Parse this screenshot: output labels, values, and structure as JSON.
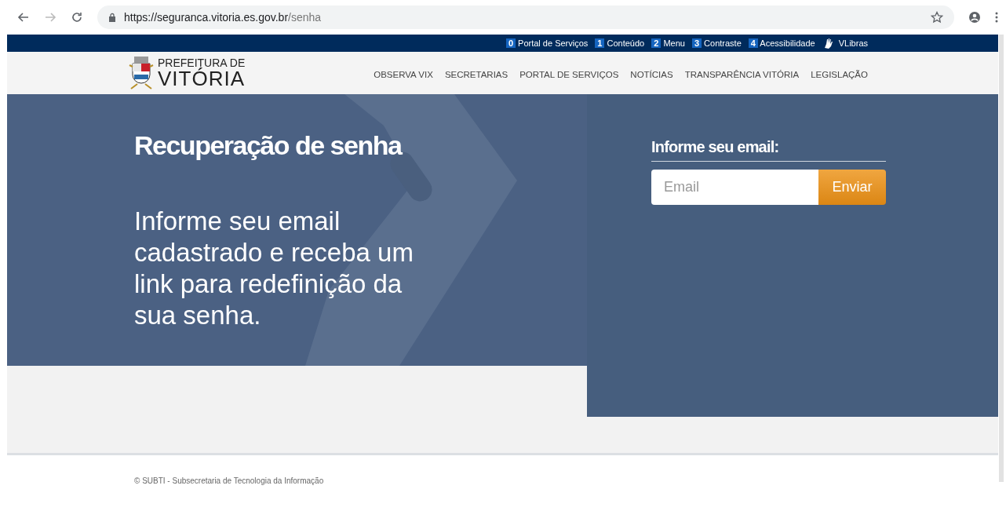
{
  "browser": {
    "url_host": "https://seguranca.vitoria.es.gov.br",
    "url_path": "/senha"
  },
  "access_bar": [
    {
      "key": "0",
      "label": "Portal de Serviços"
    },
    {
      "key": "1",
      "label": "Conteúdo"
    },
    {
      "key": "2",
      "label": "Menu"
    },
    {
      "key": "3",
      "label": "Contraste"
    },
    {
      "key": "4",
      "label": "Acessibilidade"
    }
  ],
  "vlibras": "VLibras",
  "logo": {
    "line1": "PREFEITURA DE",
    "line2": "VITÓRIA"
  },
  "nav": [
    "OBSERVA VIX",
    "SECRETARIAS",
    "PORTAL DE SERVIÇOS",
    "NOTÍCIAS",
    "TRANSPARÊNCIA VITÓRIA",
    "LEGISLAÇÃO"
  ],
  "hero": {
    "title": "Recuperação de senha",
    "text": "Informe seu email cadastrado e receba um link para redefinição da sua senha."
  },
  "form": {
    "label": "Informe seu email:",
    "placeholder": "Email",
    "button": "Enviar"
  },
  "footer": "© SUBTI - Subsecretaria de Tecnologia da Informação"
}
